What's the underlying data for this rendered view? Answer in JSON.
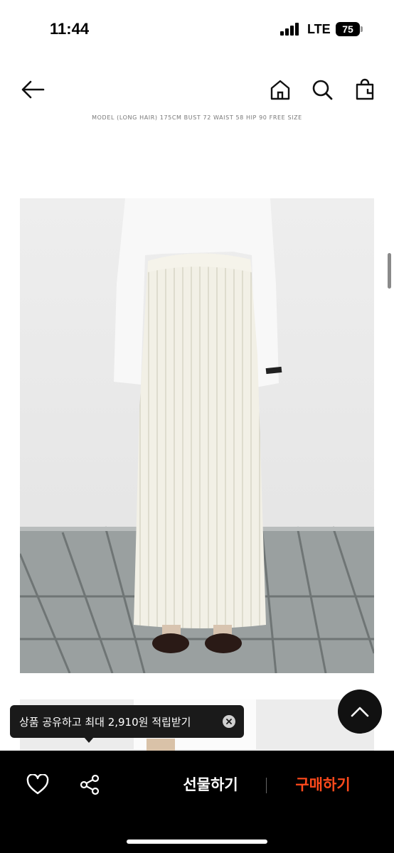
{
  "status_bar": {
    "time": "11:44",
    "network": "LTE",
    "battery": "75"
  },
  "nav": {
    "back_icon": "arrow-left-icon",
    "home_icon": "home-icon",
    "search_icon": "search-icon",
    "bag_icon": "shopping-bag-icon"
  },
  "caption": "MODEL (LONG HAIR) 175CM BUST 72 WAIST 58 HIP 90 FREE SIZE",
  "tooltip": {
    "text": "상품 공유하고 최대 2,910원 적립받기",
    "close_icon": "close-icon"
  },
  "scroll_top": {
    "icon": "chevron-up-icon"
  },
  "bottom_bar": {
    "like_icon": "heart-icon",
    "share_icon": "share-icon",
    "gift_label": "선물하기",
    "buy_label": "구매하기"
  },
  "colors": {
    "buy_accent": "#ff4a1c",
    "bottom_bar_bg": "#000000"
  }
}
